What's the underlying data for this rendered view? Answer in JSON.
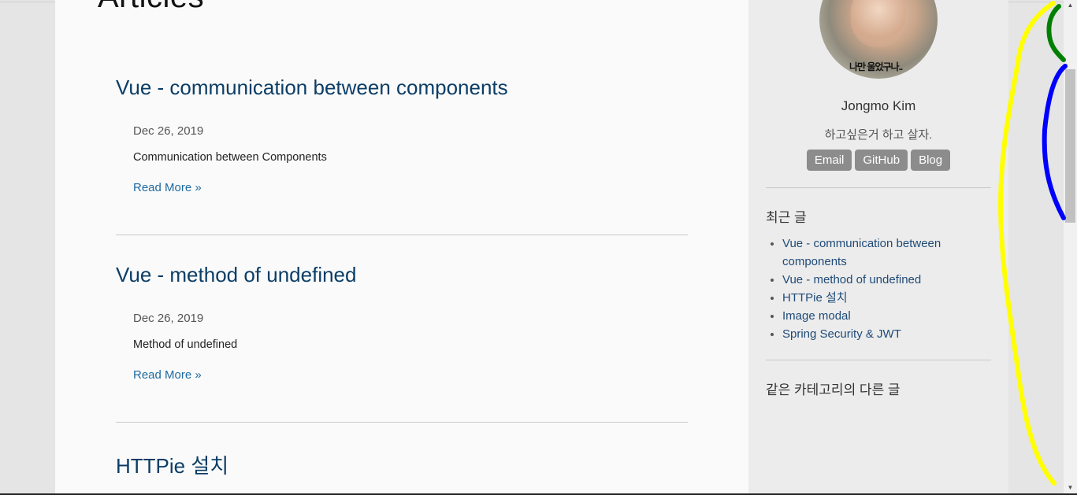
{
  "main": {
    "heading": "Articles",
    "articles": [
      {
        "title": "Vue - communication between components",
        "date": "Dec 26, 2019",
        "summary": "Communication between Components",
        "more": "Read More »"
      },
      {
        "title": "Vue - method of undefined",
        "date": "Dec 26, 2019",
        "summary": "Method of undefined",
        "more": "Read More »"
      },
      {
        "title": "HTTPie 설치"
      }
    ]
  },
  "sidebar": {
    "author_name": "Jongmo Kim",
    "author_motto": "하고싶은거 하고 살자.",
    "avatar_caption": "나만 울었구나..",
    "links": [
      {
        "label": "Email"
      },
      {
        "label": "GitHub"
      },
      {
        "label": "Blog"
      }
    ],
    "recent_heading": "최근 글",
    "recent_posts": [
      "Vue - communication between components",
      "Vue - method of undefined",
      "HTTPie 설치",
      "Image modal",
      "Spring Security & JWT"
    ],
    "category_heading": "같은 카테고리의 다른 글"
  },
  "scrollbar": {
    "up_icon": "triangle-up",
    "down_icon": "triangle-down"
  },
  "annotation_colors": {
    "yellow": "#ffff00",
    "green": "#008000",
    "blue": "#0000ff"
  }
}
